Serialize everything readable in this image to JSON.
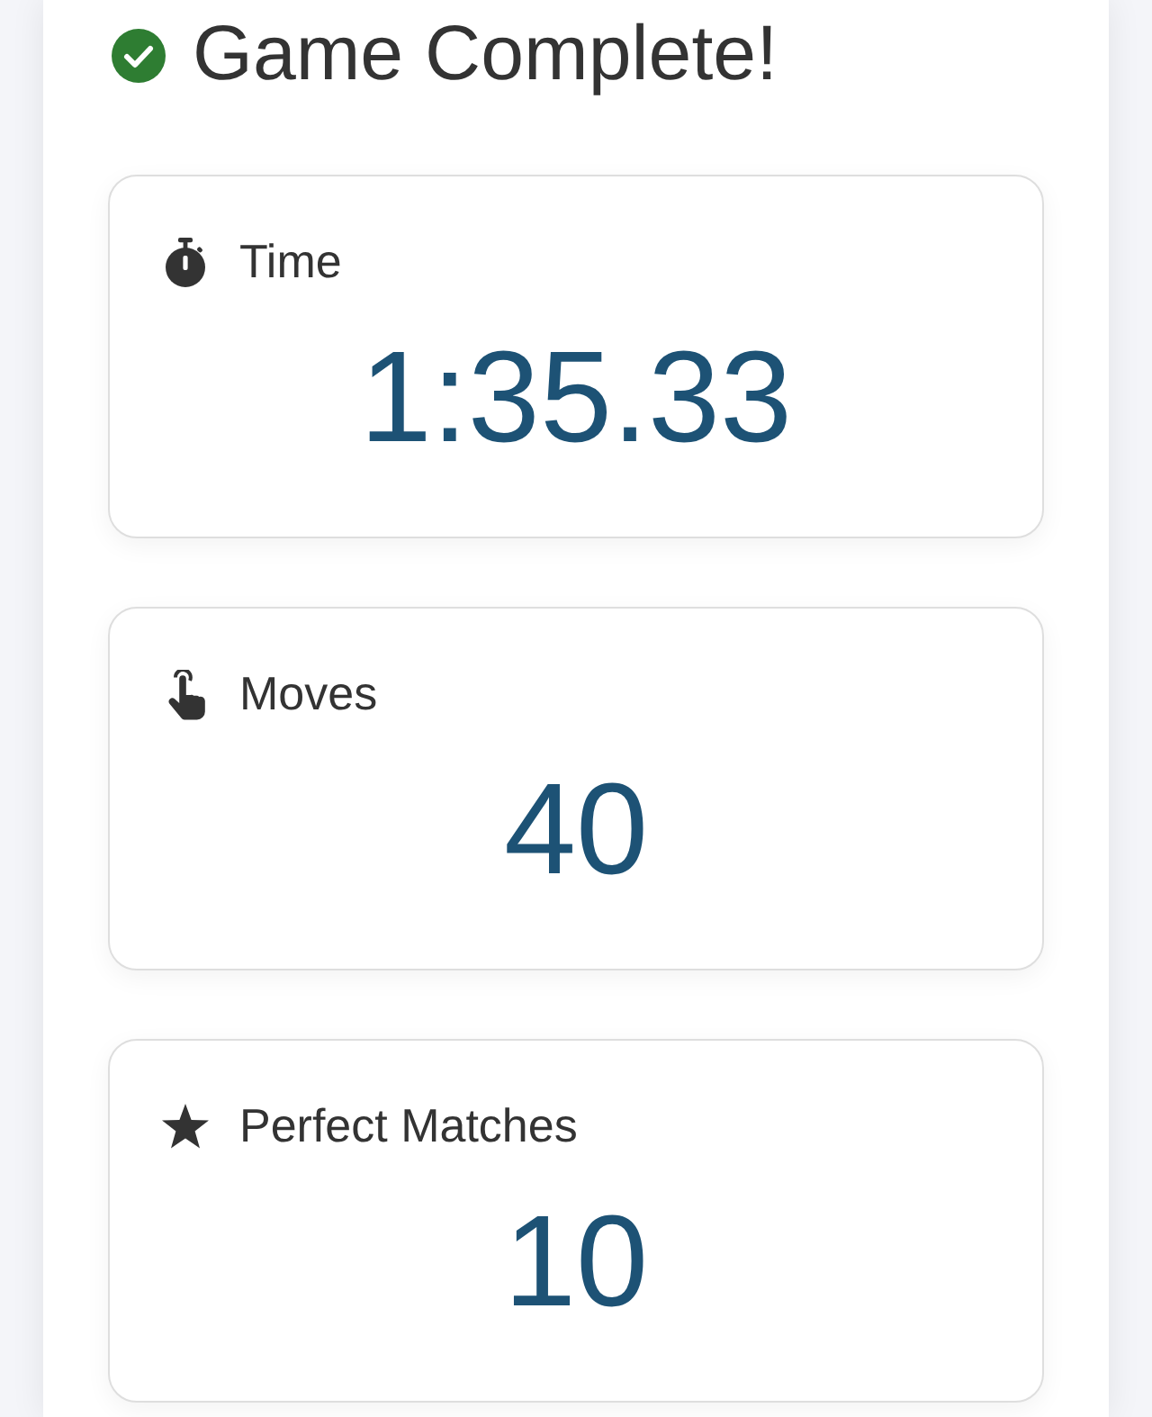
{
  "title": "Game Complete!",
  "stats": [
    {
      "kind": "time",
      "label": "Time",
      "value": "1:35.33"
    },
    {
      "kind": "moves",
      "label": "Moves",
      "value": "40"
    },
    {
      "kind": "perfect",
      "label": "Perfect Matches",
      "value": "10"
    }
  ]
}
